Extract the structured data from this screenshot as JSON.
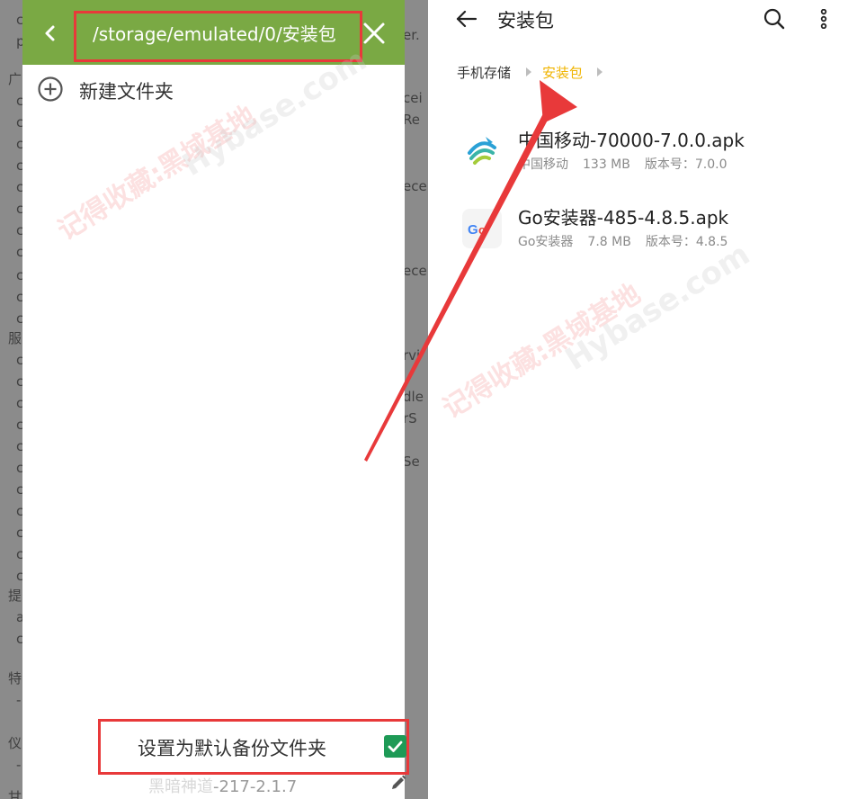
{
  "left_panel": {
    "path": "/storage/emulated/0/安装包",
    "new_folder_label": "新建文件夹",
    "default_backup_label": "设置为默认备份文件夹",
    "default_backup_checked": true,
    "bottom_file_blurred": "黑暗神道",
    "bottom_file_visible": "-217-2.1.7",
    "background_left_letters": [
      "c",
      "p",
      "广",
      "c",
      "c",
      "c",
      "c",
      "c",
      "c",
      "c",
      "c",
      "c",
      "c",
      "c",
      "服",
      "c",
      "c",
      "c",
      "c",
      "c",
      "c",
      "c",
      "c",
      "c",
      "c",
      "c",
      "提",
      "a",
      "c",
      "特",
      "-",
      "仪",
      "-",
      "甘"
    ],
    "background_right_fragments": [
      "er.",
      "cei",
      "Re",
      "ece",
      "ece",
      "rvi",
      "dle",
      "rS",
      "Se"
    ]
  },
  "right_panel": {
    "title": "安装包",
    "breadcrumbs": [
      "手机存储",
      "安装包"
    ],
    "files": [
      {
        "name": "中国移动-70000-7.0.0.apk",
        "app": "中国移动",
        "size": "133 MB",
        "version": "版本号：7.0.0",
        "icon": "china-mobile-icon"
      },
      {
        "name": "Go安装器-485-4.8.5.apk",
        "app": "Go安装器",
        "size": "7.8 MB",
        "version": "版本号：4.8.5",
        "icon": "go-installer-icon"
      }
    ]
  },
  "watermark": {
    "text": "记得收藏:黑域基地",
    "site": "Hybase.com"
  },
  "colors": {
    "header_green": "#7aa944",
    "highlight_red": "#e8393a",
    "checkbox_green": "#1e9a56",
    "breadcrumb_active": "#f0b400"
  }
}
